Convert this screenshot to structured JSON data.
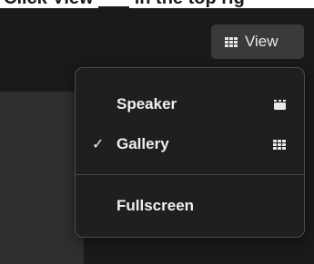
{
  "caption": {
    "text": "Click View",
    "tail": "in the top rig"
  },
  "view_button": {
    "label": "View",
    "icon": "gallery-grid-icon"
  },
  "menu": {
    "items": [
      {
        "label": "Speaker",
        "checked": false,
        "icon": "speaker-view-icon"
      },
      {
        "label": "Gallery",
        "checked": true,
        "icon": "gallery-grid-icon",
        "check_mark": "✓"
      },
      {
        "label": "Fullscreen",
        "checked": false
      }
    ]
  },
  "colors": {
    "window_bg": "#1a1a1a",
    "button_bg": "#3a3a3a",
    "menu_bg": "#1f1f1f",
    "menu_border": "#4a4a4a",
    "text": "#f0f0f0"
  }
}
